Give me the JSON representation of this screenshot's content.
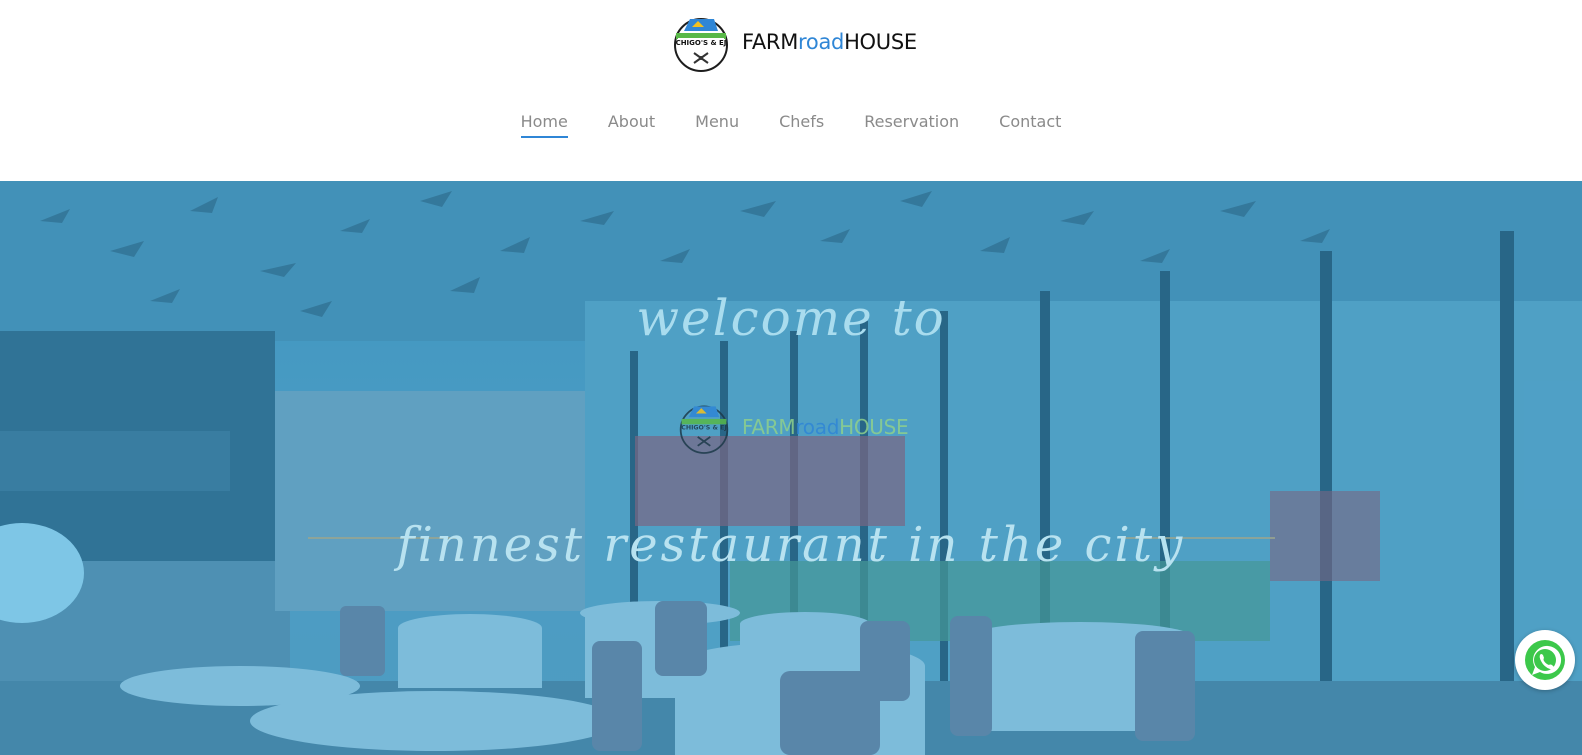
{
  "brand": {
    "name_prefix": "FARM",
    "name_accent": "road",
    "name_suffix": "HOUSE",
    "badge_text": "CHIGO'S & EJ",
    "accent_color": "#2f86d6"
  },
  "nav": {
    "items": [
      {
        "label": "Home",
        "active": true
      },
      {
        "label": "About",
        "active": false
      },
      {
        "label": "Menu",
        "active": false
      },
      {
        "label": "Chefs",
        "active": false
      },
      {
        "label": "Reservation",
        "active": false
      },
      {
        "label": "Contact",
        "active": false
      }
    ]
  },
  "hero": {
    "welcome": "welcome to",
    "tagline": "finnest restaurant in the city"
  },
  "floating": {
    "whatsapp_icon": "whatsapp-icon"
  }
}
